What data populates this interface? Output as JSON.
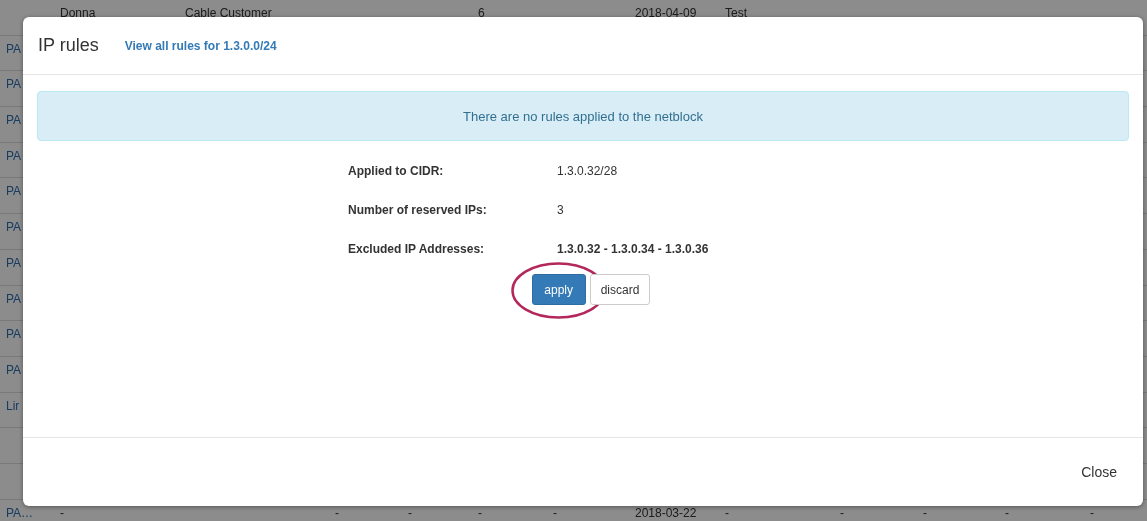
{
  "background_table": {
    "rows": [
      {
        "column_2": "Donna",
        "column_3": "Cable Customer",
        "column_6": "6",
        "column_8": "2018-04-09",
        "column_9": "Test"
      },
      {
        "column_1": "PA"
      },
      {
        "column_1": "PA"
      },
      {
        "column_1": "PA"
      },
      {
        "column_1": "PA"
      },
      {
        "column_1": "PA"
      },
      {
        "column_1": "PA"
      },
      {
        "column_1": "PA"
      },
      {
        "column_1": "PA"
      },
      {
        "column_1": "PA"
      },
      {
        "column_1": "PA"
      },
      {
        "column_1": "Lir"
      },
      {},
      {},
      {
        "column_1": "PA…",
        "column_2": "-",
        "column_4": "-",
        "column_5": "-",
        "column_6": "-",
        "column_7": "-",
        "column_8": "2018-03-22",
        "column_9": "-",
        "column_10": "-",
        "column_11": "-",
        "column_12": "-",
        "column_13": "-"
      }
    ]
  },
  "modal": {
    "title": "IP rules",
    "header_link": "View all rules for 1.3.0.0/24",
    "alert": "There are no rules applied to the netblock",
    "details": [
      {
        "label": "Applied to CIDR:",
        "value": "1.3.0.32/28",
        "bold": false
      },
      {
        "label": "Number of reserved IPs:",
        "value": "3",
        "bold": false
      },
      {
        "label": "Excluded IP Addresses:",
        "value": "1.3.0.32 - 1.3.0.34 - 1.3.0.36",
        "bold": true
      }
    ],
    "buttons": [
      {
        "label": "apply",
        "kind": "primary",
        "highlighted": true
      },
      {
        "label": "discard",
        "kind": "default",
        "highlighted": false
      }
    ],
    "footer_button": "Close"
  }
}
